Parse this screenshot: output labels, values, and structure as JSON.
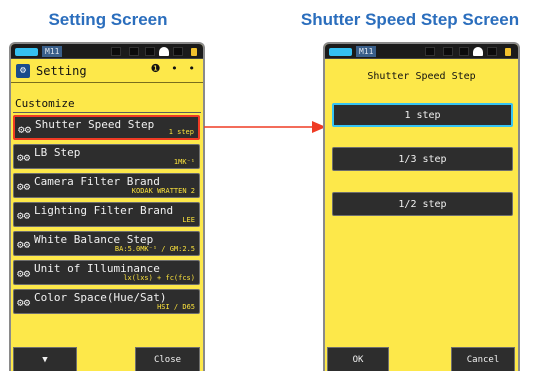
{
  "headings": {
    "left": "Setting Screen",
    "right": "Shutter Speed Step Screen"
  },
  "status_bar": {
    "memory": "M11",
    "battery_color": "#35c0f0"
  },
  "setting_screen": {
    "title": "Setting",
    "page_indicator": "❶ • •",
    "section": "Customize",
    "items": [
      {
        "label": "Shutter Speed Step",
        "value": "1 step",
        "selected": true
      },
      {
        "label": "LB Step",
        "value": "1MK⁻¹",
        "selected": false
      },
      {
        "label": "Camera Filter Brand",
        "value": "KODAK WRATTEN 2",
        "selected": false
      },
      {
        "label": "Lighting Filter Brand",
        "value": "LEE",
        "selected": false
      },
      {
        "label": "White Balance Step",
        "value": "BA:5.0MK⁻¹ / GM:2.5",
        "selected": false
      },
      {
        "label": "Unit of Illuminance",
        "value": "lx(lxs) + fc(fcs)",
        "selected": false
      },
      {
        "label": "Color Space(Hue/Sat)",
        "value": "HSI / D65",
        "selected": false
      }
    ],
    "scroll_down_label": "▼",
    "close_label": "Close"
  },
  "shutter_screen": {
    "title": "Shutter Speed Step",
    "options": [
      "1 step",
      "1/3 step",
      "1/2 step"
    ],
    "selected_index": 0,
    "ok_label": "OK",
    "cancel_label": "Cancel"
  },
  "colors": {
    "screen_bg": "#fde84a",
    "button_bg": "#2d2d2d",
    "highlight_red": "#ef3b24",
    "highlight_cyan": "#35c3f3",
    "value_yellow": "#fbe23c",
    "heading_blue": "#2b6ebd"
  },
  "icons": {
    "item_icon": "gear-icon",
    "title_icon": "setting-icon",
    "arrow": "right-arrow-icon"
  }
}
